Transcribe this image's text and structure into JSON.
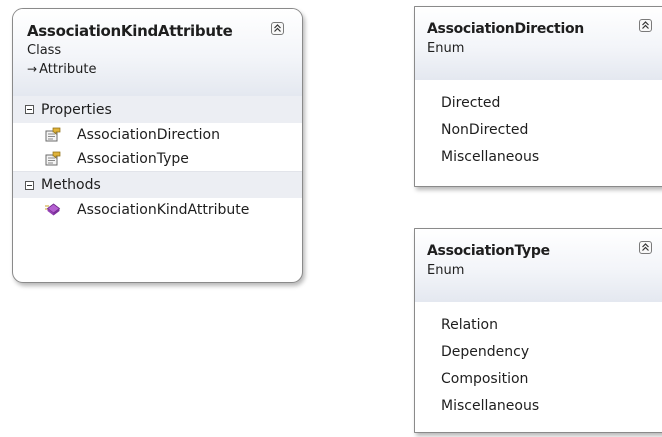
{
  "class_shape": {
    "title": "AssociationKindAttribute",
    "kind": "Class",
    "base_arrow": "→",
    "base": "Attribute",
    "properties": {
      "header": "Properties",
      "items": [
        "AssociationDirection",
        "AssociationType"
      ]
    },
    "methods": {
      "header": "Methods",
      "items": [
        "AssociationKindAttribute"
      ]
    }
  },
  "enums": [
    {
      "title": "AssociationDirection",
      "kind": "Enum",
      "values": [
        "Directed",
        "NonDirected",
        "Miscellaneous"
      ]
    },
    {
      "title": "AssociationType",
      "kind": "Enum",
      "values": [
        "Relation",
        "Dependency",
        "Composition",
        "Miscellaneous"
      ]
    }
  ],
  "icons": {
    "collapse": "double-chevron-up-icon",
    "property": "property-icon",
    "method": "method-icon",
    "section_toggle": "collapse-minus-icon"
  },
  "colors": {
    "border": "#8a8a8a",
    "compartment_bg": "#eceef3",
    "method_icon": "#a64fc4",
    "property_icon": "#d6a829"
  }
}
